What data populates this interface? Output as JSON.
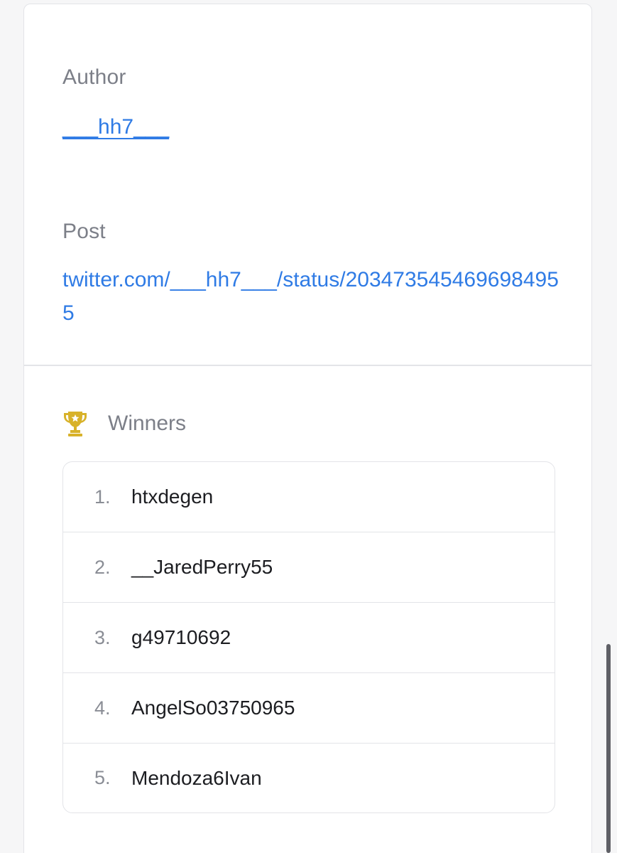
{
  "author": {
    "label": "Author",
    "value": "___hh7___"
  },
  "post": {
    "label": "Post",
    "value": "twitter.com/___hh7___/status/2034735454696984955"
  },
  "winners": {
    "title": "Winners",
    "icon": "trophy-icon",
    "icon_color": "#d8b22a",
    "items": [
      {
        "rank": "1.",
        "name": "htxdegen"
      },
      {
        "rank": "2.",
        "name": "__JaredPerry55"
      },
      {
        "rank": "3.",
        "name": "g49710692"
      },
      {
        "rank": "4.",
        "name": "AngelSo03750965"
      },
      {
        "rank": "5.",
        "name": "Mendoza6Ivan"
      }
    ]
  },
  "colors": {
    "link": "#2f7be5",
    "label": "#7c7f88",
    "border": "#e3e4e8"
  }
}
